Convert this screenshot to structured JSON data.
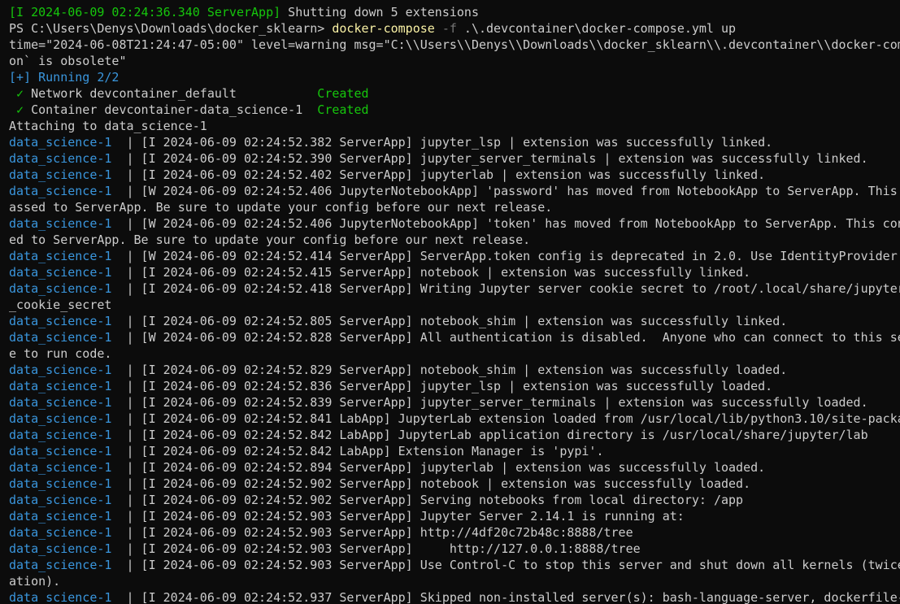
{
  "terminal": {
    "lines": [
      {
        "segs": [
          {
            "t": "[I 2024-06-09 02:24:36.340 ServerApp]",
            "c": "green"
          },
          {
            "t": " Shutting down 5 extensions",
            "c": "default"
          }
        ]
      },
      {
        "segs": [
          {
            "t": "PS C:\\Users\\Denys\\Downloads\\docker_sklearn> ",
            "c": "default"
          },
          {
            "t": "docker-compose",
            "c": "yellow"
          },
          {
            "t": " -f",
            "c": "gray"
          },
          {
            "t": " .\\.devcontainer\\docker-compose.yml up",
            "c": "default"
          }
        ]
      },
      {
        "segs": [
          {
            "t": "time=\"2024-06-08T21:24:47-05:00\" level=warning msg=\"C:\\\\Users\\\\Denys\\\\Downloads\\\\docker_sklearn\\\\.devcontainer\\\\docker-com",
            "c": "default"
          }
        ]
      },
      {
        "segs": [
          {
            "t": "on` is obsolete\"",
            "c": "default"
          }
        ]
      },
      {
        "segs": [
          {
            "t": "[+] Running 2/2",
            "c": "blue"
          }
        ]
      },
      {
        "segs": [
          {
            "t": " ✓",
            "c": "green"
          },
          {
            "t": " Network devcontainer_default           ",
            "c": "default"
          },
          {
            "t": "Created",
            "c": "green"
          }
        ]
      },
      {
        "segs": [
          {
            "t": " ✓",
            "c": "green"
          },
          {
            "t": " Container devcontainer-data_science-1  ",
            "c": "default"
          },
          {
            "t": "Created",
            "c": "green"
          }
        ]
      },
      {
        "segs": [
          {
            "t": "Attaching to data_science-1",
            "c": "default"
          }
        ]
      },
      {
        "segs": [
          {
            "t": "data_science-1",
            "c": "blue"
          },
          {
            "t": "  | [I 2024-06-09 02:24:52.382 ServerApp] jupyter_lsp | extension was successfully linked.",
            "c": "default"
          }
        ]
      },
      {
        "segs": [
          {
            "t": "data_science-1",
            "c": "blue"
          },
          {
            "t": "  | [I 2024-06-09 02:24:52.390 ServerApp] jupyter_server_terminals | extension was successfully linked.",
            "c": "default"
          }
        ]
      },
      {
        "segs": [
          {
            "t": "data_science-1",
            "c": "blue"
          },
          {
            "t": "  | [I 2024-06-09 02:24:52.402 ServerApp] jupyterlab | extension was successfully linked.",
            "c": "default"
          }
        ]
      },
      {
        "segs": [
          {
            "t": "data_science-1",
            "c": "blue"
          },
          {
            "t": "  | [W 2024-06-09 02:24:52.406 JupyterNotebookApp] 'password' has moved from NotebookApp to ServerApp. This",
            "c": "default"
          }
        ]
      },
      {
        "segs": [
          {
            "t": "assed to ServerApp. Be sure to update your config before our next release.",
            "c": "default"
          }
        ]
      },
      {
        "segs": [
          {
            "t": "data_science-1",
            "c": "blue"
          },
          {
            "t": "  | [W 2024-06-09 02:24:52.406 JupyterNotebookApp] 'token' has moved from NotebookApp to ServerApp. This con",
            "c": "default"
          }
        ]
      },
      {
        "segs": [
          {
            "t": "ed to ServerApp. Be sure to update your config before our next release.",
            "c": "default"
          }
        ]
      },
      {
        "segs": [
          {
            "t": "data_science-1",
            "c": "blue"
          },
          {
            "t": "  | [W 2024-06-09 02:24:52.414 ServerApp] ServerApp.token config is deprecated in 2.0. Use IdentityProvider.",
            "c": "default"
          }
        ]
      },
      {
        "segs": [
          {
            "t": "data_science-1",
            "c": "blue"
          },
          {
            "t": "  | [I 2024-06-09 02:24:52.415 ServerApp] notebook | extension was successfully linked.",
            "c": "default"
          }
        ]
      },
      {
        "segs": [
          {
            "t": "data_science-1",
            "c": "blue"
          },
          {
            "t": "  | [I 2024-06-09 02:24:52.418 ServerApp] Writing Jupyter server cookie secret to /root/.local/share/jupyter",
            "c": "default"
          }
        ]
      },
      {
        "segs": [
          {
            "t": "_cookie_secret",
            "c": "default"
          }
        ]
      },
      {
        "segs": [
          {
            "t": "data_science-1",
            "c": "blue"
          },
          {
            "t": "  | [I 2024-06-09 02:24:52.805 ServerApp] notebook_shim | extension was successfully linked.",
            "c": "default"
          }
        ]
      },
      {
        "segs": [
          {
            "t": "data_science-1",
            "c": "blue"
          },
          {
            "t": "  | [W 2024-06-09 02:24:52.828 ServerApp] All authentication is disabled.  Anyone who can connect to this se",
            "c": "default"
          }
        ]
      },
      {
        "segs": [
          {
            "t": "e to run code.",
            "c": "default"
          }
        ]
      },
      {
        "segs": [
          {
            "t": "data_science-1",
            "c": "blue"
          },
          {
            "t": "  | [I 2024-06-09 02:24:52.829 ServerApp] notebook_shim | extension was successfully loaded.",
            "c": "default"
          }
        ]
      },
      {
        "segs": [
          {
            "t": "data_science-1",
            "c": "blue"
          },
          {
            "t": "  | [I 2024-06-09 02:24:52.836 ServerApp] jupyter_lsp | extension was successfully loaded.",
            "c": "default"
          }
        ]
      },
      {
        "segs": [
          {
            "t": "data_science-1",
            "c": "blue"
          },
          {
            "t": "  | [I 2024-06-09 02:24:52.839 ServerApp] jupyter_server_terminals | extension was successfully loaded.",
            "c": "default"
          }
        ]
      },
      {
        "segs": [
          {
            "t": "data_science-1",
            "c": "blue"
          },
          {
            "t": "  | [I 2024-06-09 02:24:52.841 LabApp] JupyterLab extension loaded from /usr/local/lib/python3.10/site-packa",
            "c": "default"
          }
        ]
      },
      {
        "segs": [
          {
            "t": "data_science-1",
            "c": "blue"
          },
          {
            "t": "  | [I 2024-06-09 02:24:52.842 LabApp] JupyterLab application directory is /usr/local/share/jupyter/lab",
            "c": "default"
          }
        ]
      },
      {
        "segs": [
          {
            "t": "data_science-1",
            "c": "blue"
          },
          {
            "t": "  | [I 2024-06-09 02:24:52.842 LabApp] Extension Manager is 'pypi'.",
            "c": "default"
          }
        ]
      },
      {
        "segs": [
          {
            "t": "data_science-1",
            "c": "blue"
          },
          {
            "t": "  | [I 2024-06-09 02:24:52.894 ServerApp] jupyterlab | extension was successfully loaded.",
            "c": "default"
          }
        ]
      },
      {
        "segs": [
          {
            "t": "data_science-1",
            "c": "blue"
          },
          {
            "t": "  | [I 2024-06-09 02:24:52.902 ServerApp] notebook | extension was successfully loaded.",
            "c": "default"
          }
        ]
      },
      {
        "segs": [
          {
            "t": "data_science-1",
            "c": "blue"
          },
          {
            "t": "  | [I 2024-06-09 02:24:52.902 ServerApp] Serving notebooks from local directory: /app",
            "c": "default"
          }
        ]
      },
      {
        "segs": [
          {
            "t": "data_science-1",
            "c": "blue"
          },
          {
            "t": "  | [I 2024-06-09 02:24:52.903 ServerApp] Jupyter Server 2.14.1 is running at:",
            "c": "default"
          }
        ]
      },
      {
        "segs": [
          {
            "t": "data_science-1",
            "c": "blue"
          },
          {
            "t": "  | [I 2024-06-09 02:24:52.903 ServerApp] http://4df20c72b48c:8888/tree",
            "c": "default"
          }
        ]
      },
      {
        "segs": [
          {
            "t": "data_science-1",
            "c": "blue"
          },
          {
            "t": "  | [I 2024-06-09 02:24:52.903 ServerApp]     http://127.0.0.1:8888/tree",
            "c": "default"
          }
        ]
      },
      {
        "segs": [
          {
            "t": "data_science-1",
            "c": "blue"
          },
          {
            "t": "  | [I 2024-06-09 02:24:52.903 ServerApp] Use Control-C to stop this server and shut down all kernels (twice",
            "c": "default"
          }
        ]
      },
      {
        "segs": [
          {
            "t": "ation).",
            "c": "default"
          }
        ]
      },
      {
        "segs": [
          {
            "t": "data_science-1",
            "c": "blue"
          },
          {
            "t": "  | [I 2024-06-09 02:24:52.937 ServerApp] Skipped non-installed server(s): bash-language-server, dockerfile-",
            "c": "default"
          }
        ]
      }
    ]
  },
  "colors": {
    "background": "#0c0c0c",
    "default": "#cccccc",
    "green": "#16c60c",
    "blue": "#3a96dd",
    "yellow": "#f9f1a5",
    "gray": "#767676"
  }
}
